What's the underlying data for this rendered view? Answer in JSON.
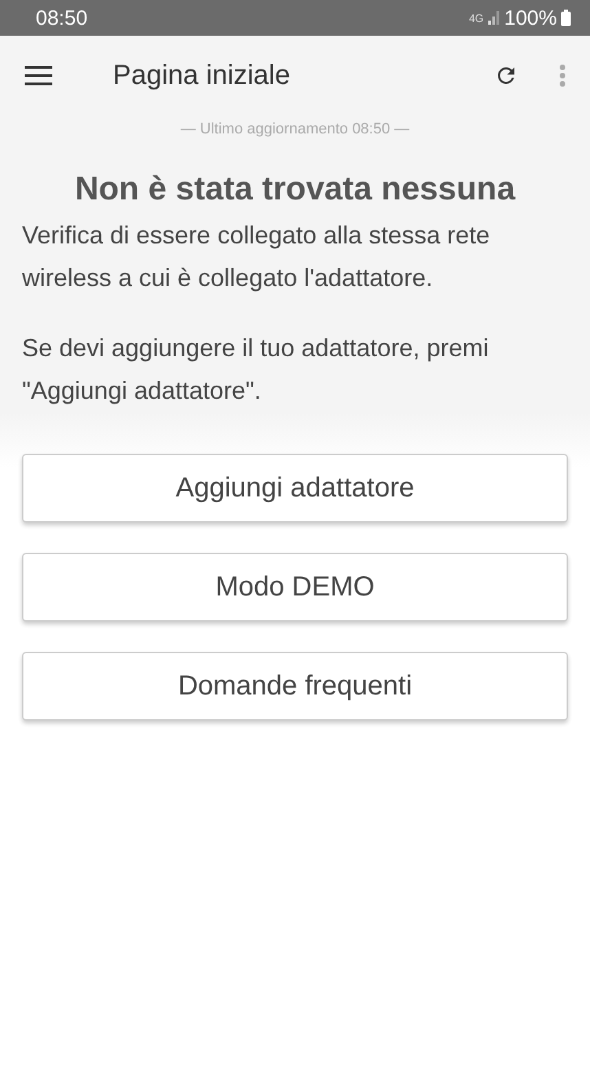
{
  "status_bar": {
    "time": "08:50",
    "network": "4G",
    "battery": "100%"
  },
  "app_bar": {
    "title": "Pagina iniziale"
  },
  "last_update": "— Ultimo aggiornamento 08:50 —",
  "heading": "Non è stata trovata nessuna",
  "paragraphs": [
    "Verifica di essere collegato alla stessa rete wireless a cui è collegato l'adattatore.",
    "Se devi aggiungere il tuo adattatore, premi \"Aggiungi adattatore\"."
  ],
  "buttons": [
    "Aggiungi adattatore",
    "Modo DEMO",
    "Domande frequenti"
  ]
}
